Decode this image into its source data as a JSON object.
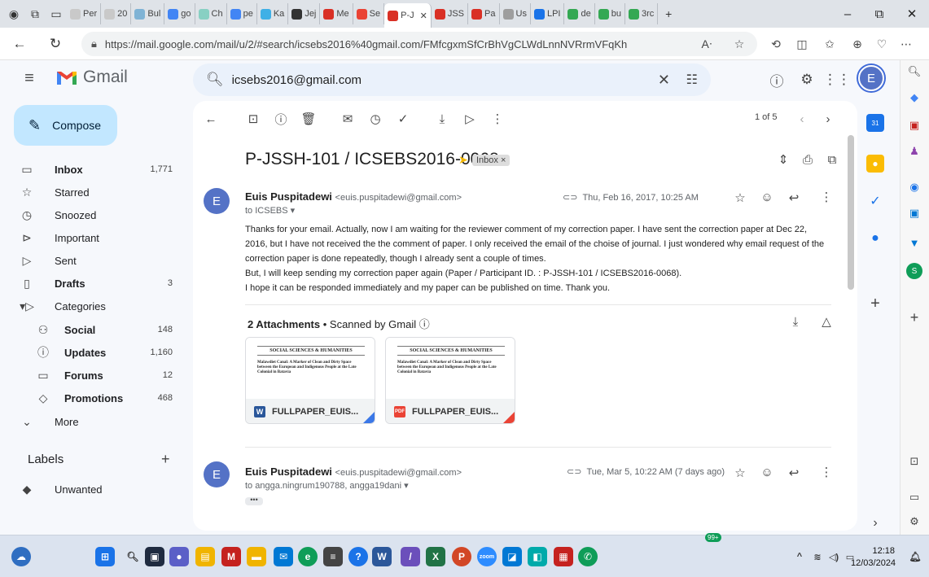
{
  "browser": {
    "tabs": [
      {
        "label": "Per",
        "color": "#c9c9c9"
      },
      {
        "label": "20",
        "color": "#c9c9c9"
      },
      {
        "label": "Bul",
        "color": "#7fb3d5"
      },
      {
        "label": "go",
        "color": "#4285f4"
      },
      {
        "label": "Ch",
        "color": "#88d0c3"
      },
      {
        "label": "pe",
        "color": "#4285f4"
      },
      {
        "label": "Ka",
        "color": "#3fb0e6"
      },
      {
        "label": "Jej",
        "color": "#333333"
      },
      {
        "label": "Me",
        "color": "#d93025"
      },
      {
        "label": "Se",
        "color": "#ea4335"
      },
      {
        "label": "P-J",
        "color": "#ffffff",
        "active": true
      },
      {
        "label": "JSS",
        "color": "#d93025"
      },
      {
        "label": "Pa",
        "color": "#d93025"
      },
      {
        "label": "Us",
        "color": "#9e9e9e"
      },
      {
        "label": "LPI",
        "color": "#1a73e8"
      },
      {
        "label": "de",
        "color": "#34a853"
      },
      {
        "label": "bu",
        "color": "#34a853"
      },
      {
        "label": "3rc",
        "color": "#34a853"
      }
    ],
    "new_tab": "+",
    "url": "https://mail.google.com/mail/u/2/#search/icsebs2016%40gmail.com/FMfcgxmSfCrBhVgCLWdLnnNVRrmVFqKh"
  },
  "gmail": {
    "app_name": "Gmail",
    "search_value": "icsebs2016@gmail.com",
    "avatar_letter": "E",
    "compose_label": "Compose"
  },
  "sidebar": {
    "items": [
      {
        "icon": "inbox-icon",
        "glyph": "▭",
        "label": "Inbox",
        "count": "1,771",
        "bold": true
      },
      {
        "icon": "star-icon",
        "glyph": "☆",
        "label": "Starred",
        "count": ""
      },
      {
        "icon": "clock-icon",
        "glyph": "◷",
        "label": "Snoozed",
        "count": ""
      },
      {
        "icon": "important-icon",
        "glyph": "⊳",
        "label": "Important",
        "count": ""
      },
      {
        "icon": "send-icon",
        "glyph": "▷",
        "label": "Sent",
        "count": ""
      },
      {
        "icon": "draft-icon",
        "glyph": "▯",
        "label": "Drafts",
        "count": "3",
        "bold": true
      },
      {
        "icon": "label-icon",
        "glyph": "▾▷",
        "label": "Categories",
        "count": ""
      },
      {
        "icon": "social-icon",
        "glyph": "⚇",
        "label": "Social",
        "count": "148",
        "bold": true,
        "sub": true
      },
      {
        "icon": "info-icon",
        "glyph": "ⓘ",
        "label": "Updates",
        "count": "1,160",
        "bold": true,
        "sub": true
      },
      {
        "icon": "forum-icon",
        "glyph": "▭",
        "label": "Forums",
        "count": "12",
        "bold": true,
        "sub": true
      },
      {
        "icon": "tag-icon",
        "glyph": "◇",
        "label": "Promotions",
        "count": "468",
        "bold": true,
        "sub": true
      },
      {
        "icon": "chevron-down-icon",
        "glyph": "⌄",
        "label": "More",
        "count": ""
      }
    ],
    "labels_title": "Labels",
    "labels_add": "+",
    "labels": [
      {
        "label": "Unwanted"
      }
    ]
  },
  "thread": {
    "pager": "1 of 5",
    "subject": "P-JSSH-101 / ICSEBS2016-0068",
    "inbox_chip": "Inbox ×",
    "messages": [
      {
        "avatar": "E",
        "sender": "Euis Puspitadewi",
        "email": "<euis.puspitadewi@gmail.com>",
        "to": "to ICSEBS ▾",
        "date": "Thu, Feb 16, 2017, 10:25 AM",
        "body": [
          "Thanks for your email. Actually, now I am waiting for the reviewer comment of my correction paper. I have sent the correction paper at Dec 22, 2016, but I have not received the the comment of paper. I only received the email of the choise of journal. I just wondered why email request of the correction paper is done repeatedly, though I already sent a couple of times.",
          "But, I will keep sending my correction paper  again (Paper / Participant ID. : P-JSSH-101 / ICSEBS2016-0068).",
          "I hope it can be responded immediately and my paper can be published on time. Thank you."
        ]
      },
      {
        "avatar": "E",
        "sender": "Euis Puspitadewi",
        "email": "<euis.puspitadewi@gmail.com>",
        "to": "to angga.ningrum190788, angga19dani ▾",
        "date": "Tue, Mar 5, 10:22 AM (7 days ago)",
        "dots": "•••"
      }
    ],
    "attachments": {
      "count_label": "2 Attachments",
      "scanned": "• Scanned by Gmail ⓘ",
      "files": [
        {
          "name": "FULLPAPER_EUIS...",
          "badge": "W",
          "badge_color": "#2b579a",
          "corner": "#3b78e7",
          "preview_title": "SOCIAL SCIENCES & HUMANITIES",
          "preview_text": "Malawdiet Canal: A Marker of Clean and Dirty Space between the European and Indigenous People at the Late Colonial in Batavia"
        },
        {
          "name": "FULLPAPER_EUIS...",
          "badge": "PDF",
          "badge_color": "#ea4335",
          "corner": "#ea4335",
          "preview_title": "SOCIAL SCIENCES & HUMANITIES",
          "preview_text": "Malawdiet Canal: A Marker of Clean and Dirty Space between the European and Indigenous People at the Late Colonial in Batavia"
        }
      ]
    }
  },
  "taskbar": {
    "time": "12:18",
    "date": "12/03/2024",
    "notif_badge": "99+"
  }
}
